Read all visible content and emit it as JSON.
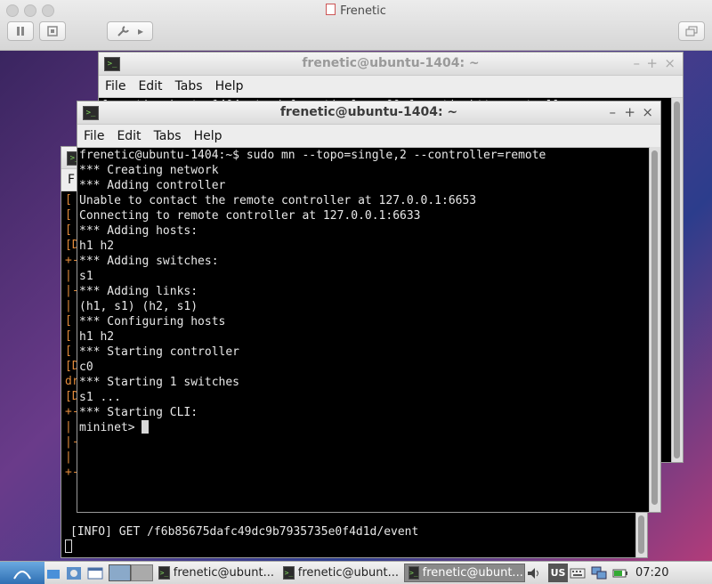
{
  "vm": {
    "title": "Frenetic",
    "pause_icon": "pause-icon",
    "snapshot_icon": "snapshot-icon",
    "settings_icon": "wrench-icon",
    "arrow_icon": "play-arrow-icon",
    "fullscreen_icon": "windows-icon"
  },
  "windows": {
    "back": {
      "title": "frenetic@ubuntu-1404: ~",
      "menu": [
        "File",
        "Edit",
        "Tabs",
        "Help"
      ],
      "peek_line": "frenetic@ubuntu-1404:~$ cd frenetic-lang && frenetic http-controller"
    },
    "left": {
      "left_chars": [
        "[",
        "[",
        "[",
        "[D",
        "+-",
        "|",
        "|-",
        "|",
        "[",
        "[",
        "[",
        "[D",
        "dr",
        "[D",
        "+-",
        "|",
        "|-",
        "|",
        "+-"
      ],
      "bottom_line": "[INFO] GET /f6b85675dafc49dc9b7935735e0f4d1d/event"
    },
    "front": {
      "title": "frenetic@ubuntu-1404: ~",
      "menu": [
        "File",
        "Edit",
        "Tabs",
        "Help"
      ],
      "lines": [
        "frenetic@ubuntu-1404:~$ sudo mn --topo=single,2 --controller=remote",
        "*** Creating network",
        "*** Adding controller",
        "Unable to contact the remote controller at 127.0.0.1:6653",
        "Connecting to remote controller at 127.0.0.1:6633",
        "*** Adding hosts:",
        "h1 h2",
        "*** Adding switches:",
        "s1",
        "*** Adding links:",
        "(h1, s1) (h2, s1)",
        "*** Configuring hosts",
        "h1 h2",
        "*** Starting controller",
        "c0",
        "*** Starting 1 switches",
        "s1 ...",
        "*** Starting CLI:"
      ],
      "prompt": "mininet> "
    }
  },
  "taskbar": {
    "tasks": [
      {
        "label": "frenetic@ubunt...",
        "active": false
      },
      {
        "label": "frenetic@ubunt...",
        "active": false
      },
      {
        "label": "frenetic@ubunt...",
        "active": true
      }
    ],
    "keyboard_layout": "US",
    "clock": "07:20",
    "colors": {
      "terminal_bg": "#000000",
      "terminal_fg": "#e8e8e8",
      "active_task": "#8a8a8a"
    }
  }
}
